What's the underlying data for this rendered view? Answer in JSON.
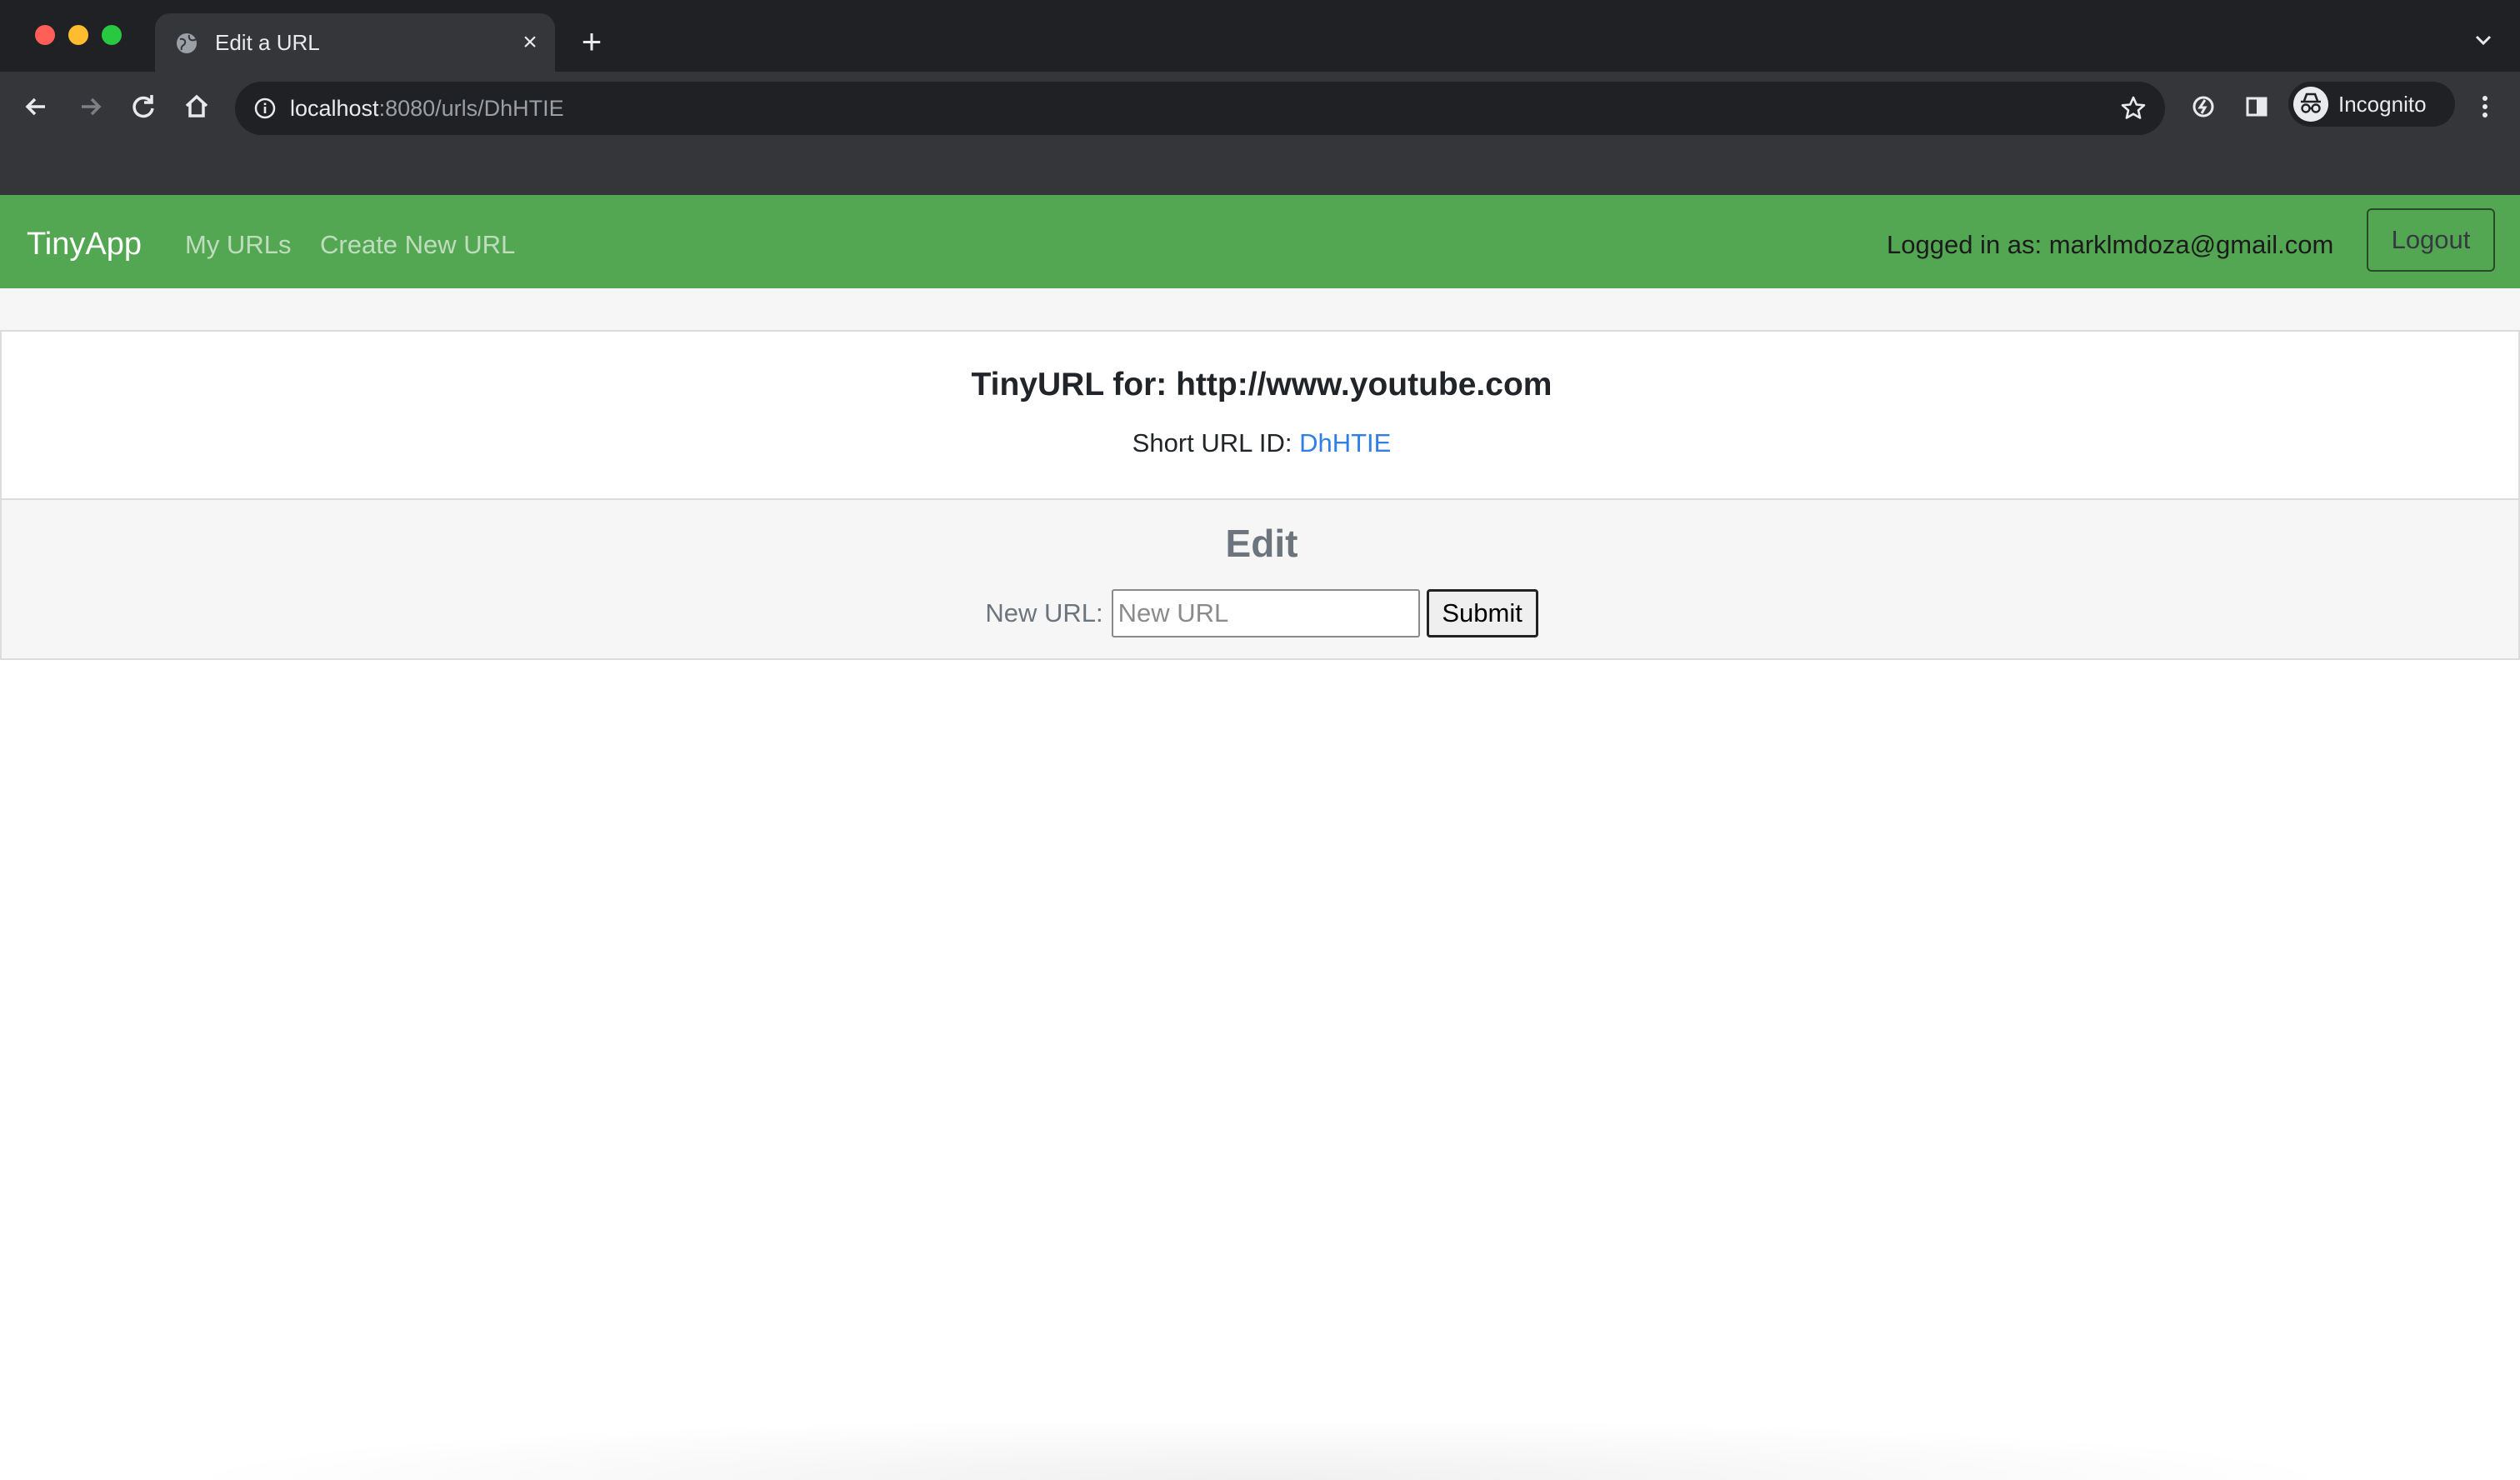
{
  "browser": {
    "tab_title": "Edit a URL",
    "tab_close": "×",
    "new_tab": "+",
    "url_host": "localhost",
    "url_path": ":8080/urls/DhHTIE",
    "profile_label": "Incognito",
    "icons": [
      "globe-icon",
      "back-icon",
      "forward-icon",
      "reload-icon",
      "home-icon",
      "info-icon",
      "star-icon",
      "extensions-icon",
      "side-panel-icon",
      "incognito-icon",
      "menu-icon",
      "tab-search-icon"
    ]
  },
  "navbar": {
    "brand": "TinyApp",
    "links": [
      "My URLs",
      "Create New URL"
    ],
    "logged_in_text": "Logged in as: marklmdoza@gmail.com",
    "logout_label": "Logout",
    "color": "#54a752"
  },
  "card": {
    "title": "TinyURL for: http://www.youtube.com",
    "short_label": "Short URL ID: ",
    "short_id": "DhHTIE",
    "link_color": "#2f7fe6"
  },
  "edit": {
    "heading": "Edit",
    "label": "New URL:",
    "input_value": "",
    "placeholder": "New URL",
    "submit_label": "Submit"
  }
}
